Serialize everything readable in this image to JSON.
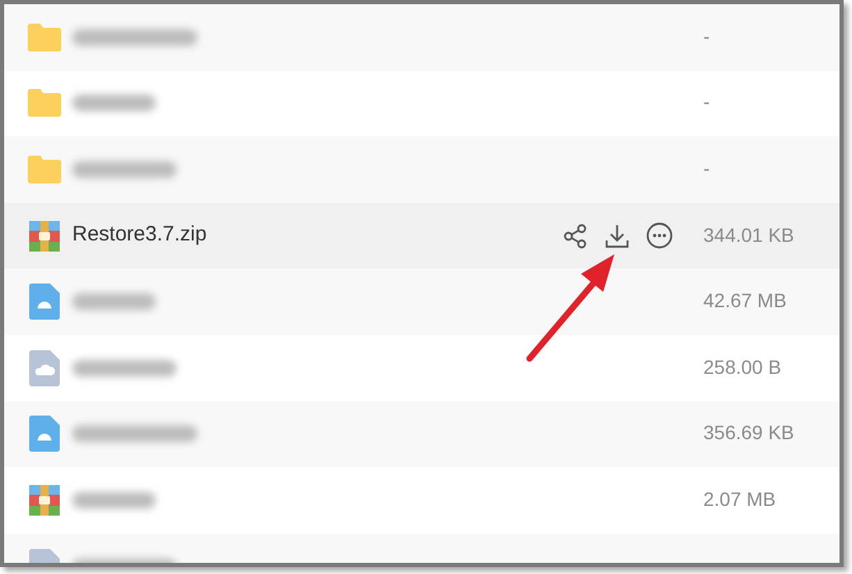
{
  "files": [
    {
      "kind": "folder",
      "redacted": true,
      "size": "-",
      "selected": false
    },
    {
      "kind": "folder",
      "redacted": true,
      "size": "-",
      "selected": false
    },
    {
      "kind": "folder",
      "redacted": true,
      "size": "-",
      "selected": false
    },
    {
      "kind": "archive",
      "redacted": false,
      "name": "Restore3.7.zip",
      "size": "344.01 KB",
      "selected": true
    },
    {
      "kind": "image",
      "redacted": true,
      "size": "42.67 MB",
      "selected": false
    },
    {
      "kind": "cloud",
      "redacted": true,
      "size": "258.00 B",
      "selected": false
    },
    {
      "kind": "image",
      "redacted": true,
      "size": "356.69 KB",
      "selected": false
    },
    {
      "kind": "archive",
      "redacted": true,
      "size": "2.07 MB",
      "selected": false
    },
    {
      "kind": "cloud",
      "redacted": true,
      "selected": false
    }
  ],
  "annotation": {
    "kind": "arrow",
    "color": "#e0222a"
  }
}
